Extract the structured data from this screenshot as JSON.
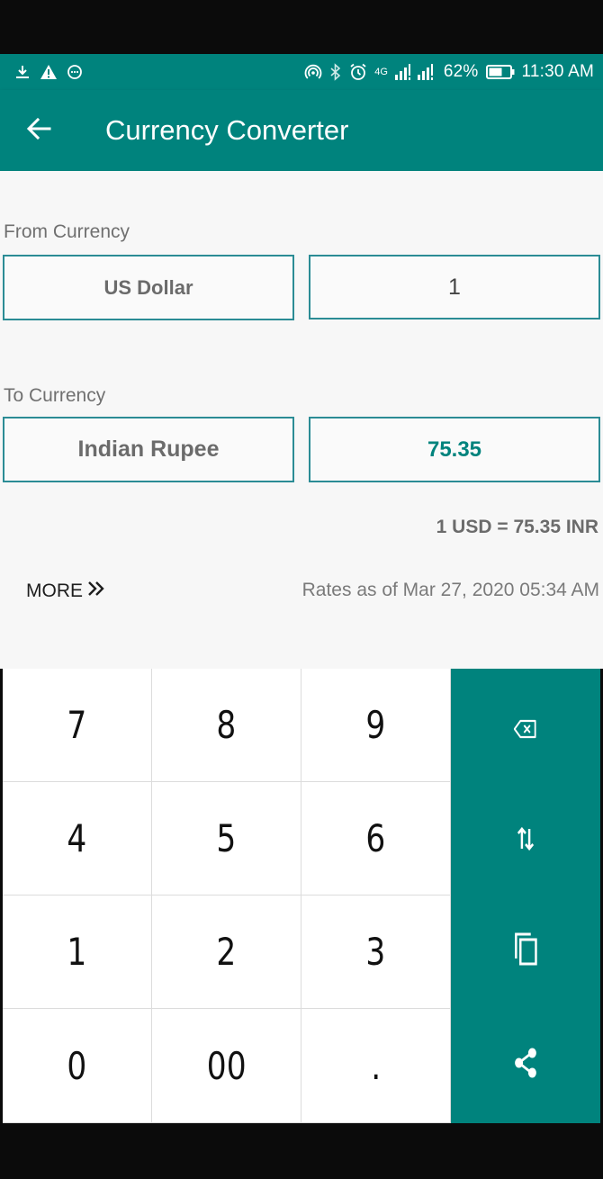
{
  "status_bar": {
    "network": "4G",
    "battery": "62%",
    "time": "11:30 AM",
    "icons": [
      "download-icon",
      "warning-icon",
      "chat-bubble-icon",
      "hotspot-icon",
      "bluetooth-icon",
      "alarm-icon",
      "signal-icon",
      "battery-icon"
    ]
  },
  "app_bar": {
    "title": "Currency Converter",
    "back_icon": "arrow-left-icon"
  },
  "from": {
    "label": "From Currency",
    "currency": "US Dollar",
    "amount": "1"
  },
  "to": {
    "label": "To Currency",
    "currency": "Indian Rupee",
    "result": "75.35"
  },
  "rate_text": "1 USD = 75.35 INR",
  "more_label": "MORE",
  "updated_text": "Rates as of Mar 27, 2020 05:34 AM",
  "keypad": {
    "keys": [
      "7",
      "8",
      "9",
      "4",
      "5",
      "6",
      "1",
      "2",
      "3",
      "0",
      "00",
      "."
    ],
    "actions": [
      "backspace-icon",
      "swap-icon",
      "copy-icon",
      "share-icon"
    ]
  },
  "colors": {
    "primary": "#00837d",
    "input_border": "#2b8c95",
    "cursor": "#c2185b"
  }
}
